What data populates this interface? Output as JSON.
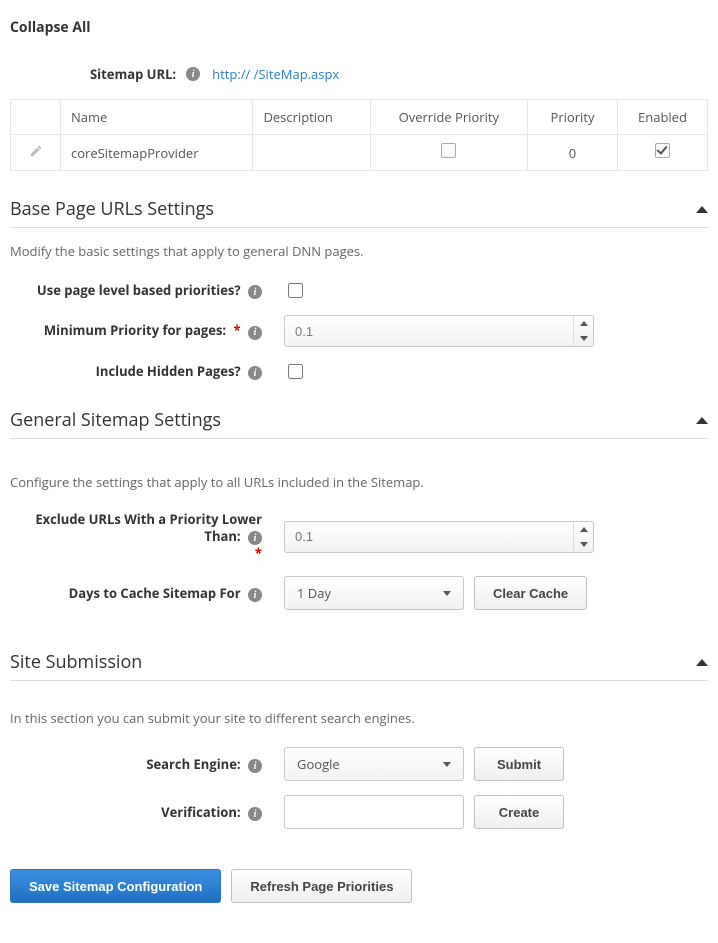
{
  "collapse_all": "Collapse All",
  "sitemap_url": {
    "label": "Sitemap URL:",
    "value": "http://                                                       /SiteMap.aspx"
  },
  "grid": {
    "headers": {
      "name": "Name",
      "description": "Description",
      "override": "Override Priority",
      "priority": "Priority",
      "enabled": "Enabled"
    },
    "rows": [
      {
        "name": "coreSitemapProvider",
        "description": "",
        "override": false,
        "priority": "0",
        "enabled": true
      }
    ]
  },
  "sections": {
    "base": {
      "title": "Base Page URLs Settings",
      "desc": "Modify the basic settings that apply to general DNN pages.",
      "labels": {
        "use_page_level": "Use page level based priorities?",
        "min_priority": "Minimum Priority for pages:",
        "include_hidden": "Include Hidden Pages?"
      },
      "values": {
        "min_priority": "0.1"
      }
    },
    "general": {
      "title": "General Sitemap Settings",
      "desc": "Configure the settings that apply to all URLs included in the Sitemap.",
      "labels": {
        "exclude": "Exclude URLs With a Priority Lower Than:",
        "days_cache": "Days to Cache Sitemap For"
      },
      "values": {
        "exclude": "0.1",
        "days_cache": "1 Day"
      },
      "buttons": {
        "clear_cache": "Clear Cache"
      }
    },
    "submission": {
      "title": "Site Submission",
      "desc": "In this section you can submit your site to different search engines.",
      "labels": {
        "search_engine": "Search Engine:",
        "verification": "Verification:"
      },
      "values": {
        "search_engine": "Google",
        "verification": ""
      },
      "buttons": {
        "submit": "Submit",
        "create": "Create"
      }
    }
  },
  "footer": {
    "save": "Save Sitemap Configuration",
    "refresh": "Refresh Page Priorities"
  }
}
